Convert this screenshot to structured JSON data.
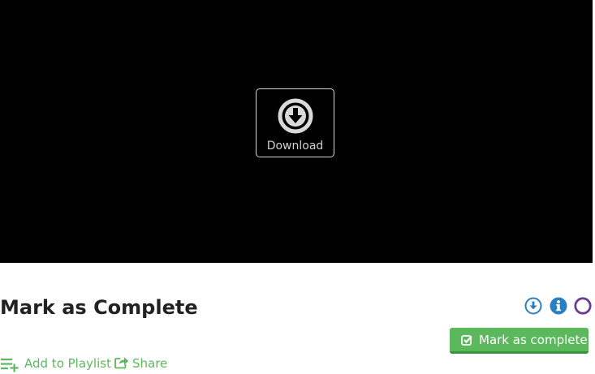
{
  "video": {
    "download_overlay_label": "Download"
  },
  "lesson": {
    "title": "Mark as Complete"
  },
  "status_icons": [
    {
      "name": "download-circle-icon",
      "color": "#2a7fc1"
    },
    {
      "name": "info-icon",
      "color": "#2a7fc1"
    },
    {
      "name": "incomplete-circle-icon",
      "color": "#6b3d8f"
    }
  ],
  "actions": {
    "mark_complete_label": "Mark as complete",
    "add_to_playlist_label": "Add to Playlist",
    "share_label": "Share"
  },
  "colors": {
    "accent_green": "#5cb85c",
    "info_blue": "#2a7fc1",
    "status_purple": "#6b3d8f"
  }
}
